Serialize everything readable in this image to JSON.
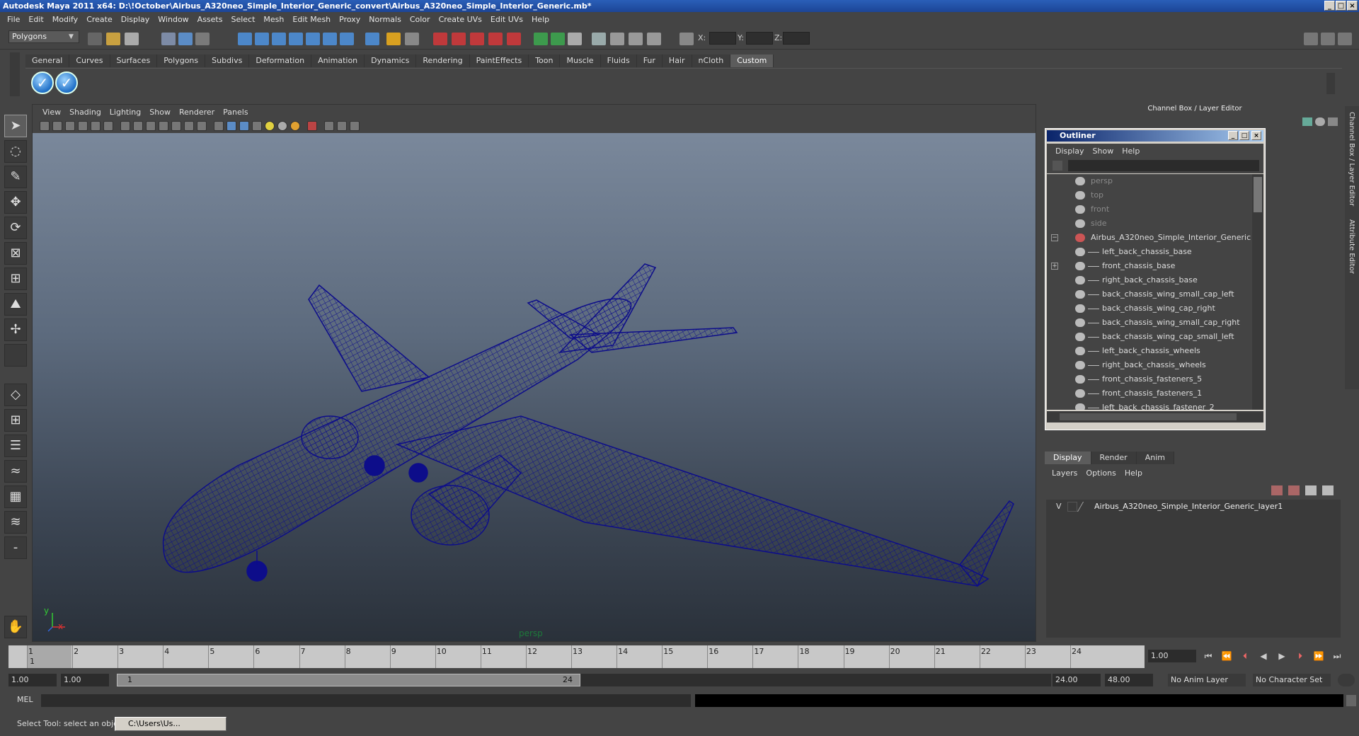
{
  "window": {
    "title": "Autodesk Maya 2011 x64: D:\\!October\\Airbus_A320neo_Simple_Interior_Generic_convert\\Airbus_A320neo_Simple_Interior_Generic.mb*",
    "min_label": "_",
    "max_label": "□",
    "close_label": "×"
  },
  "menubar": [
    "File",
    "Edit",
    "Modify",
    "Create",
    "Display",
    "Window",
    "Assets",
    "Select",
    "Mesh",
    "Edit Mesh",
    "Proxy",
    "Normals",
    "Color",
    "Create UVs",
    "Edit UVs",
    "Help"
  ],
  "statusline": {
    "mode": "Polygons",
    "x_label": "X:",
    "y_label": "Y:",
    "z_label": "Z:"
  },
  "shelf": {
    "tabs": [
      "General",
      "Curves",
      "Surfaces",
      "Polygons",
      "Subdivs",
      "Deformation",
      "Animation",
      "Dynamics",
      "Rendering",
      "PaintEffects",
      "Toon",
      "Muscle",
      "Fluids",
      "Fur",
      "Hair",
      "nCloth",
      "Custom"
    ],
    "active_tab": "Custom",
    "buttons": [
      "check-icon",
      "check-icon"
    ]
  },
  "viewport": {
    "menu": [
      "View",
      "Shading",
      "Lighting",
      "Show",
      "Renderer",
      "Panels"
    ],
    "camera_label": "persp",
    "axis_y": "y",
    "axis_x": "x",
    "wireframe_color": "#0d0d8a"
  },
  "channel_box": {
    "header": "Channel Box / Layer Editor",
    "side_tab_1": "Channel Box / Layer Editor",
    "side_tab_2": "Attribute Editor"
  },
  "outliner": {
    "title": "Outliner",
    "menu": [
      "Display",
      "Show",
      "Help"
    ],
    "items": [
      {
        "label": "persp",
        "dim": true
      },
      {
        "label": "top",
        "dim": true
      },
      {
        "label": "front",
        "dim": true
      },
      {
        "label": "side",
        "dim": true
      },
      {
        "label": "Airbus_A320neo_Simple_Interior_Generic",
        "dim": false
      },
      {
        "label": "left_back_chassis_base",
        "dim": false
      },
      {
        "label": "front_chassis_base",
        "dim": false
      },
      {
        "label": "right_back_chassis_base",
        "dim": false
      },
      {
        "label": "back_chassis_wing_small_cap_left",
        "dim": false
      },
      {
        "label": "back_chassis_wing_cap_right",
        "dim": false
      },
      {
        "label": "back_chassis_wing_small_cap_right",
        "dim": false
      },
      {
        "label": "back_chassis_wing_cap_small_left",
        "dim": false
      },
      {
        "label": "left_back_chassis_wheels",
        "dim": false
      },
      {
        "label": "right_back_chassis_wheels",
        "dim": false
      },
      {
        "label": "front_chassis_fasteners_5",
        "dim": false
      },
      {
        "label": "front_chassis_fasteners_1",
        "dim": false
      },
      {
        "label": "left_back_chassis_fastener_2",
        "dim": false
      }
    ]
  },
  "layer_editor": {
    "tabs": [
      "Display",
      "Render",
      "Anim"
    ],
    "active_tab": "Display",
    "menu": [
      "Layers",
      "Options",
      "Help"
    ],
    "layer_visible": "V",
    "layer_name": "Airbus_A320neo_Simple_Interior_Generic_layer1"
  },
  "timeline": {
    "ticks": [
      "1",
      "2",
      "3",
      "4",
      "5",
      "6",
      "7",
      "8",
      "9",
      "10",
      "11",
      "12",
      "13",
      "14",
      "15",
      "16",
      "17",
      "18",
      "19",
      "20",
      "21",
      "22",
      "23",
      "24"
    ],
    "current_frame_marker": "1",
    "current_frame": "1.00"
  },
  "range": {
    "start": "1.00",
    "playback_start": "1.00",
    "slider_start": "1",
    "slider_end": "24",
    "playback_end": "24.00",
    "end": "48.00",
    "anim_layer": "No Anim Layer",
    "character_set": "No Character Set"
  },
  "command_line": {
    "label": "MEL"
  },
  "help_line": {
    "text": "Select Tool: select an object",
    "task": "C:\\Users\\Us..."
  }
}
